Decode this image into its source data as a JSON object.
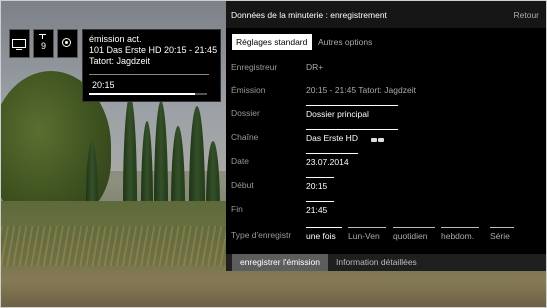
{
  "osd": {
    "channel_number": "9",
    "tv_icon": "tv-icon",
    "record_icon": "record-icon"
  },
  "info": {
    "title": "émission act.",
    "program": "101 Das Erste HD 20:15 - 21:45",
    "name": "Tatort: Jagdzeit",
    "time": "20:15",
    "progress": 0.9
  },
  "panel": {
    "title": "Données de la minuterie : enregistrement",
    "back_label": "Retour",
    "tabs": [
      {
        "label": "Réglages standard",
        "selected": true
      },
      {
        "label": "Autres options",
        "selected": false
      }
    ],
    "rows": [
      {
        "label": "Enregistreur",
        "value": "DR+"
      },
      {
        "label": "Émission",
        "value": "20:15 - 21:45 Tatort: Jagdzeit"
      },
      {
        "label": "Dossier",
        "value": "Dossier principal"
      },
      {
        "label": "Chaîne",
        "value": "Das Erste HD"
      },
      {
        "label": "Date",
        "value": "23.07.2014"
      },
      {
        "label": "Début",
        "value": "20:15"
      },
      {
        "label": "Fin",
        "value": "21:45"
      }
    ],
    "type_label": "Type d'enregistr",
    "type_options": [
      "une fois",
      "Lun-Ven",
      "quotidien",
      "hebdom.",
      "Série"
    ],
    "type_selected": "une fois",
    "footer": {
      "record_label": "enregistrer l'émission",
      "info_label": "Information détaillées"
    }
  },
  "colors": {
    "panel_bg": "#000000",
    "highlight_bg": "#ffffff",
    "button_bg": "#5d5d5d"
  }
}
